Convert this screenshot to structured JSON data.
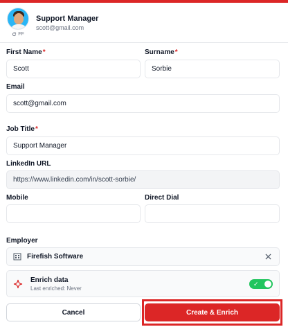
{
  "header": {
    "title": "Support Manager",
    "email": "scott@gmail.com",
    "avatar_badge": "FF"
  },
  "form": {
    "first_name": {
      "label": "First Name",
      "required_mark": "*",
      "value": "Scott"
    },
    "surname": {
      "label": "Surname",
      "required_mark": "*",
      "value": "Sorbie"
    },
    "email": {
      "label": "Email",
      "value": "scott@gmail.com"
    },
    "job_title": {
      "label": "Job Title",
      "required_mark": "*",
      "value": "Support Manager"
    },
    "linkedin": {
      "label": "LinkedIn URL",
      "value": "https://www.linkedin.com/in/scott-sorbie/"
    },
    "mobile": {
      "label": "Mobile",
      "value": ""
    },
    "direct_dial": {
      "label": "Direct Dial",
      "value": ""
    },
    "employer": {
      "label": "Employer",
      "value": "Firefish Software",
      "clear_icon": "close-icon"
    },
    "enrich": {
      "title": "Enrich data",
      "subtitle": "Last enriched: Never",
      "enabled": true
    }
  },
  "actions": {
    "cancel_label": "Cancel",
    "create_label": "Create & Enrich"
  },
  "colors": {
    "accent": "#dc2626",
    "toggle_on": "#22c55e"
  }
}
